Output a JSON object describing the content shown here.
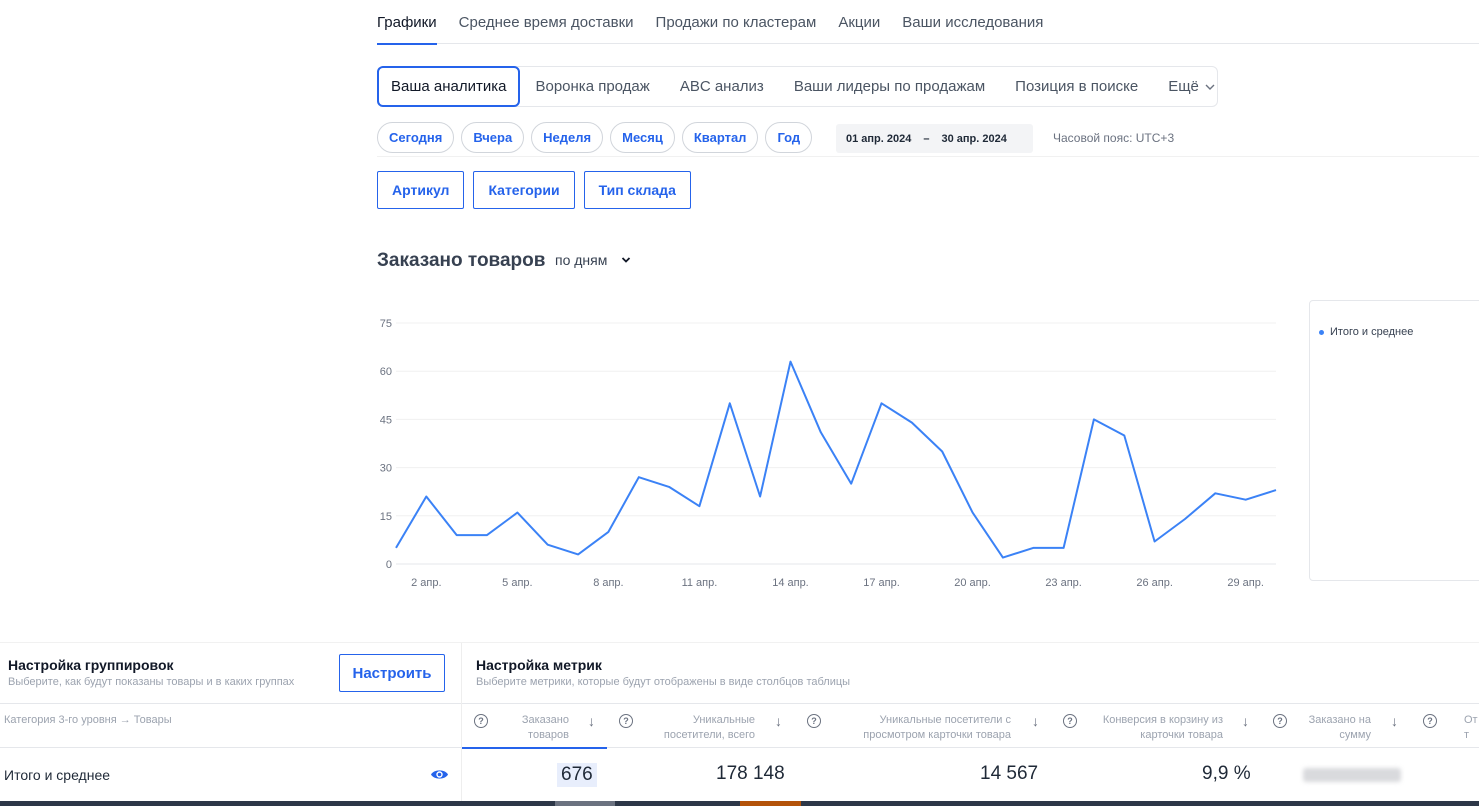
{
  "topnav": {
    "tabs": [
      {
        "label": "Графики",
        "active": true
      },
      {
        "label": "Среднее время доставки"
      },
      {
        "label": "Продажи по кластерам"
      },
      {
        "label": "Акции"
      },
      {
        "label": "Ваши исследования"
      }
    ]
  },
  "subnav": {
    "tabs": [
      {
        "label": "Ваша аналитика",
        "active": true
      },
      {
        "label": "Воронка продаж"
      },
      {
        "label": "ABC анализ"
      },
      {
        "label": "Ваши лидеры по продажам"
      },
      {
        "label": "Позиция в поиске"
      }
    ],
    "more_label": "Ещё"
  },
  "periods": [
    "Сегодня",
    "Вчера",
    "Неделя",
    "Месяц",
    "Квартал",
    "Год"
  ],
  "date_range": {
    "from": "01 апр. 2024",
    "separator": "–",
    "to": "30 апр. 2024"
  },
  "timezone": "Часовой пояс: UTC+3",
  "filters": [
    "Артикул",
    "Категории",
    "Тип склада"
  ],
  "chart_section": {
    "title": "Заказано товаров",
    "granularity": "по дням"
  },
  "chart_data": {
    "type": "line",
    "x_ticks": [
      "2 апр.",
      "5 апр.",
      "8 апр.",
      "11 апр.",
      "14 апр.",
      "17 апр.",
      "20 апр.",
      "23 апр.",
      "26 апр.",
      "29 апр."
    ],
    "y_ticks": [
      0,
      15,
      30,
      45,
      60,
      75
    ],
    "ylim": [
      0,
      75
    ],
    "x_days": [
      1,
      30
    ],
    "grid": true,
    "legend_position": "right",
    "series": [
      {
        "name": "Итого и среднее",
        "color": "#3b82f6",
        "values": [
          5,
          21,
          9,
          9,
          16,
          6,
          3,
          10,
          27,
          24,
          18,
          50,
          21,
          63,
          41,
          25,
          50,
          44,
          35,
          16,
          2,
          5,
          5,
          45,
          40,
          7,
          14,
          22,
          20,
          23
        ]
      }
    ]
  },
  "grouping": {
    "title": "Настройка группировок",
    "description": "Выберите, как будут показаны товары и в каких группах",
    "button": "Настроить"
  },
  "metrics": {
    "title": "Настройка метрик",
    "description": "Выберите метрики, которые будут отображены в виде столбцов таблицы"
  },
  "table": {
    "first_column": "Категория 3-го уровня → Товары",
    "columns": [
      {
        "line1": "Заказано",
        "line2": "товаров"
      },
      {
        "line1": "Уникальные",
        "line2": "посетители, всего"
      },
      {
        "line1": "Уникальные посетители с",
        "line2": "просмотром карточки товара"
      },
      {
        "line1": "Конверсия в корзину из",
        "line2": "карточки товара"
      },
      {
        "line1": "Заказано на",
        "line2": "сумму"
      },
      {
        "line1": "От",
        "line2": "т"
      }
    ],
    "row": {
      "label": "Итого и среднее",
      "values": [
        "676",
        "178 148",
        "14 567",
        "9,9 %"
      ]
    }
  },
  "icons": {
    "sort": "arrow-down-icon",
    "help": "question-circle-icon",
    "visibility": "eye-icon",
    "dropdown": "chevron-down-icon"
  },
  "colors": {
    "accent": "#2563eb",
    "line": "#3b82f6"
  }
}
